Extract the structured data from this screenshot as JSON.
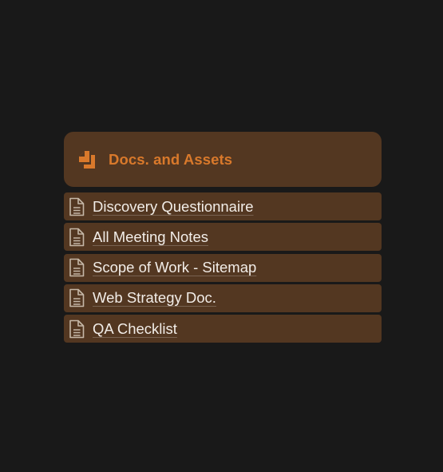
{
  "colors": {
    "page_background": "#191919",
    "panel_background": "#533721",
    "accent": "#d9792b",
    "text": "#f2ede8"
  },
  "header": {
    "icon": "copy-documents-icon",
    "title": "Docs. and Assets"
  },
  "items": [
    {
      "icon": "document-icon",
      "label": "Discovery Questionnaire"
    },
    {
      "icon": "document-icon",
      "label": "All Meeting Notes"
    },
    {
      "icon": "document-icon",
      "label": "Scope of Work - Sitemap"
    },
    {
      "icon": "document-icon",
      "label": "Web Strategy Doc."
    },
    {
      "icon": "document-icon",
      "label": "QA Checklist"
    }
  ]
}
